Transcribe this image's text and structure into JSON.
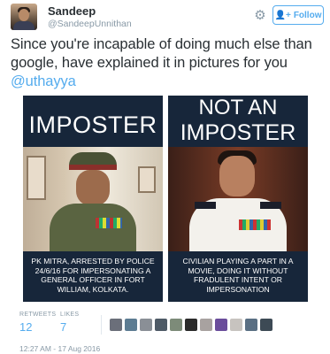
{
  "user": {
    "name": "Sandeep",
    "handle": "@SandeepUnnithan"
  },
  "actions": {
    "follow_label": "Follow",
    "follow_icon": "add-user-icon",
    "more_icon": "gear-icon"
  },
  "tweet": {
    "text": "Since you're incapable of doing much else than google, have explained it in pictures for you",
    "mention": "@uthayya"
  },
  "image": {
    "left": {
      "heading": "IMPOSTER",
      "caption": "PK MITRA, ARRESTED BY POLICE 24/6/16 FOR IMPERSONATING A GENERAL OFFICER IN FORT WILLIAM, KOLKATA."
    },
    "right": {
      "heading_line1": "NOT AN",
      "heading_line2": "IMPOSTER",
      "caption": "CIVILIAN PLAYING A PART IN A MOVIE, DOING IT WITHOUT FRADULENT INTENT OR IMPERSONATION"
    }
  },
  "stats": {
    "retweets_label": "RETWEETS",
    "retweets_value": "12",
    "likes_label": "LIKES",
    "likes_value": "7"
  },
  "likers_colors": [
    "#6b6f7a",
    "#5d7c92",
    "#8a8f96",
    "#4e5a66",
    "#7d8b79",
    "#2b2b2b",
    "#a8a2a0",
    "#6a4d9b",
    "#c7c3bf",
    "#5a6f83",
    "#3d4a55"
  ],
  "timestamp": "12:27 AM - 17 Aug 2016",
  "colors": {
    "accent": "#55acee",
    "muted": "#8899a6",
    "text": "#292f33"
  }
}
